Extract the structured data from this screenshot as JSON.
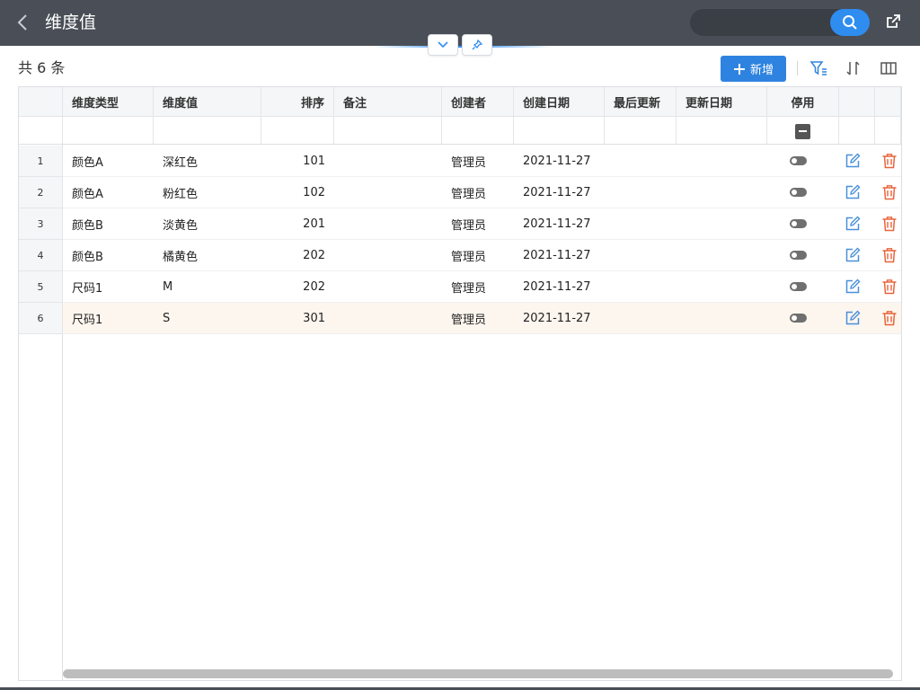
{
  "header": {
    "title": "维度值",
    "back_icon": "chevron-left-icon",
    "search_placeholder": "",
    "search_icon": "search-icon",
    "export_icon": "external-link-icon",
    "bg_color": "#4a4f57",
    "accent_color": "#2f8df0"
  },
  "panel_controls": {
    "collapse_icon": "chevron-down-icon",
    "pin_icon": "pin-icon"
  },
  "toolbar": {
    "count_label": "共 6 条",
    "add_label": "新增",
    "add_icon": "plus-icon",
    "filter_icon": "filter-icon",
    "sort_icon": "sort-icon",
    "columns_icon": "columns-icon"
  },
  "table": {
    "columns": [
      "维度类型",
      "维度值",
      "排序",
      "备注",
      "创建者",
      "创建日期",
      "最后更新",
      "更新日期",
      "停用"
    ],
    "rows": [
      {
        "num": "1",
        "type": "颜色A",
        "value": "深红色",
        "sort": "101",
        "note": "",
        "creator": "管理员",
        "created": "2021-11-27",
        "last_update": "",
        "update_date": "",
        "disabled": false
      },
      {
        "num": "2",
        "type": "颜色A",
        "value": "粉红色",
        "sort": "102",
        "note": "",
        "creator": "管理员",
        "created": "2021-11-27",
        "last_update": "",
        "update_date": "",
        "disabled": false
      },
      {
        "num": "3",
        "type": "颜色B",
        "value": "淡黄色",
        "sort": "201",
        "note": "",
        "creator": "管理员",
        "created": "2021-11-27",
        "last_update": "",
        "update_date": "",
        "disabled": false
      },
      {
        "num": "4",
        "type": "颜色B",
        "value": "橘黄色",
        "sort": "202",
        "note": "",
        "creator": "管理员",
        "created": "2021-11-27",
        "last_update": "",
        "update_date": "",
        "disabled": false
      },
      {
        "num": "5",
        "type": "尺码1",
        "value": "M",
        "sort": "202",
        "note": "",
        "creator": "管理员",
        "created": "2021-11-27",
        "last_update": "",
        "update_date": "",
        "disabled": false
      },
      {
        "num": "6",
        "type": "尺码1",
        "value": "S",
        "sort": "301",
        "note": "",
        "creator": "管理员",
        "created": "2021-11-27",
        "last_update": "",
        "update_date": "",
        "disabled": false
      }
    ],
    "edit_icon": "edit-icon",
    "delete_icon": "trash-icon",
    "edit_color": "#4a90d9",
    "delete_color": "#e8643c",
    "highlight_row_color": "#fdf6ee"
  }
}
